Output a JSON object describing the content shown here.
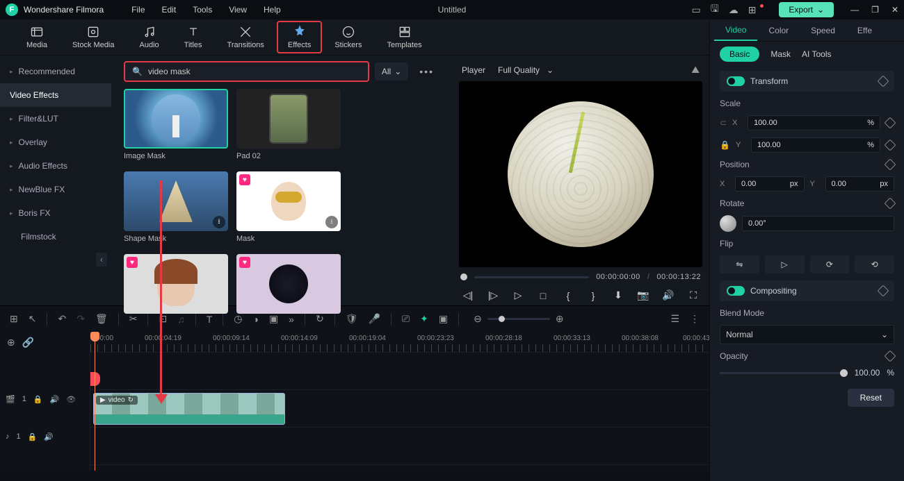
{
  "app": {
    "name": "Wondershare Filmora",
    "doc_title": "Untitled",
    "export_label": "Export"
  },
  "menu": [
    "File",
    "Edit",
    "Tools",
    "View",
    "Help"
  ],
  "lib_tabs": [
    "Media",
    "Stock Media",
    "Audio",
    "Titles",
    "Transitions",
    "Effects",
    "Stickers",
    "Templates"
  ],
  "lib_tabs_active": "Effects",
  "sidebar": {
    "items": [
      {
        "label": "Recommended",
        "active": false
      },
      {
        "label": "Video Effects",
        "active": true
      },
      {
        "label": "Filter&LUT",
        "active": false
      },
      {
        "label": "Overlay",
        "active": false
      },
      {
        "label": "Audio Effects",
        "active": false
      },
      {
        "label": "NewBlue FX",
        "active": false
      },
      {
        "label": "Boris FX",
        "active": false
      },
      {
        "label": "Filmstock",
        "active": false
      }
    ]
  },
  "search": {
    "value": "video mask",
    "filter": "All"
  },
  "effects": [
    {
      "label": "Image Mask",
      "selected": true,
      "kind": "lighthouse"
    },
    {
      "label": "Pad 02",
      "selected": false,
      "kind": "pad"
    },
    {
      "label": "Shape Mask",
      "selected": false,
      "kind": "shape",
      "dl": true
    },
    {
      "label": "Mask",
      "selected": false,
      "kind": "mask",
      "badge": true,
      "dl": true
    },
    {
      "label": "",
      "selected": false,
      "kind": "face2",
      "badge": true
    },
    {
      "label": "",
      "selected": false,
      "kind": "dark",
      "badge": true
    }
  ],
  "player": {
    "label": "Player",
    "quality": "Full Quality",
    "time_current": "00:00:00:00",
    "time_total": "00:00:13:22"
  },
  "timeline": {
    "ticks": [
      "00:00",
      "00:00:04:19",
      "00:00:09:14",
      "00:00:14:09",
      "00:00:19:04",
      "00:00:23:23",
      "00:00:28:18",
      "00:00:33:13",
      "00:00:38:08",
      "00:00:43"
    ],
    "clip_label": "video"
  },
  "inspector": {
    "tabs": [
      "Video",
      "Color",
      "Speed",
      "Effe"
    ],
    "tab_active": "Video",
    "subtabs": [
      "Basic",
      "Mask",
      "AI Tools"
    ],
    "sub_active": "Basic",
    "transform_label": "Transform",
    "scale_label": "Scale",
    "scale_x": "100.00",
    "scale_y": "100.00",
    "scale_unit": "%",
    "position_label": "Position",
    "pos_x": "0.00",
    "pos_y": "0.00",
    "pos_unit": "px",
    "rotate_label": "Rotate",
    "rotate_val": "0.00°",
    "flip_label": "Flip",
    "compositing_label": "Compositing",
    "blend_label": "Blend Mode",
    "blend_val": "Normal",
    "opacity_label": "Opacity",
    "opacity_val": "100.00",
    "opacity_unit": "%",
    "reset_label": "Reset"
  }
}
